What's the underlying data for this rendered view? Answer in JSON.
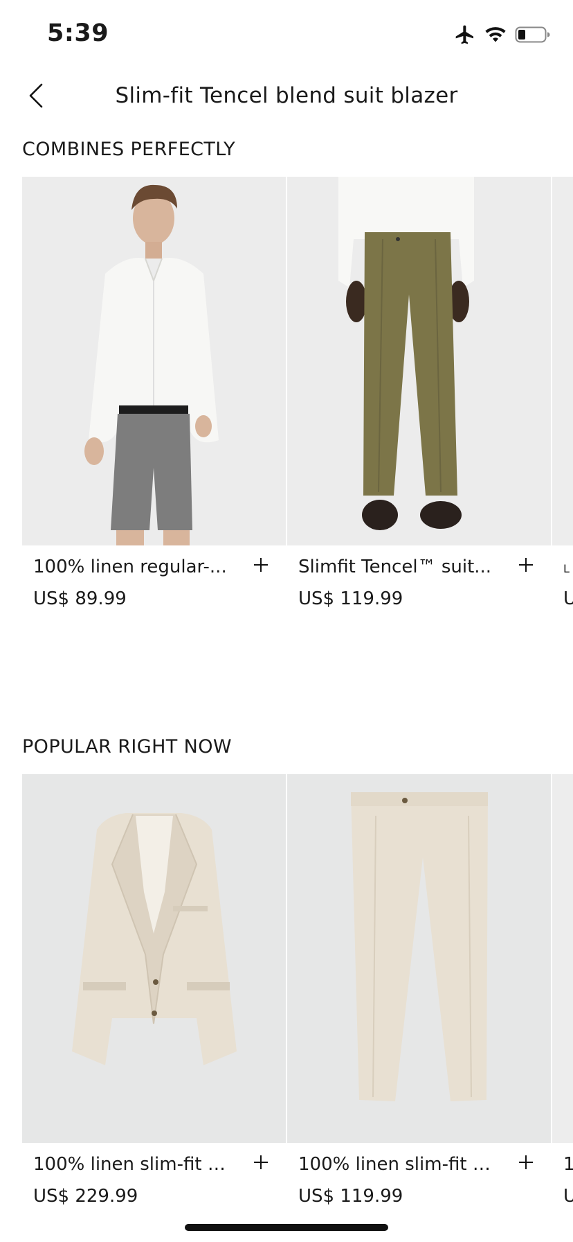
{
  "status_bar": {
    "time": "5:39",
    "icons": [
      "airplane-icon",
      "wifi-icon",
      "battery-icon"
    ]
  },
  "header": {
    "title": "Slim-fit Tencel blend suit blazer",
    "back_icon": "chevron-left-icon"
  },
  "sections": [
    {
      "title": "COMBINES PERFECTLY",
      "products": [
        {
          "name": "100% linen regular-...",
          "price": "US$ 89.99"
        },
        {
          "name": "Slimfit Tencel™ suit...",
          "price": "US$ 119.99"
        },
        {
          "name": "L",
          "price": "U"
        }
      ]
    },
    {
      "title": "POPULAR RIGHT NOW",
      "products": [
        {
          "name": "100% linen slim-fit s...",
          "price": "US$ 229.99"
        },
        {
          "name": "100% linen slim-fit s...",
          "price": "US$ 119.99"
        },
        {
          "name": "1",
          "price": "U"
        }
      ]
    }
  ],
  "colors": {
    "background": "#ffffff",
    "text": "#1a1a1a",
    "image_bg": "#ededed",
    "linen": "#e9e3d7",
    "olive": "#7c7548",
    "grey_shorts": "#7d7d7d"
  }
}
